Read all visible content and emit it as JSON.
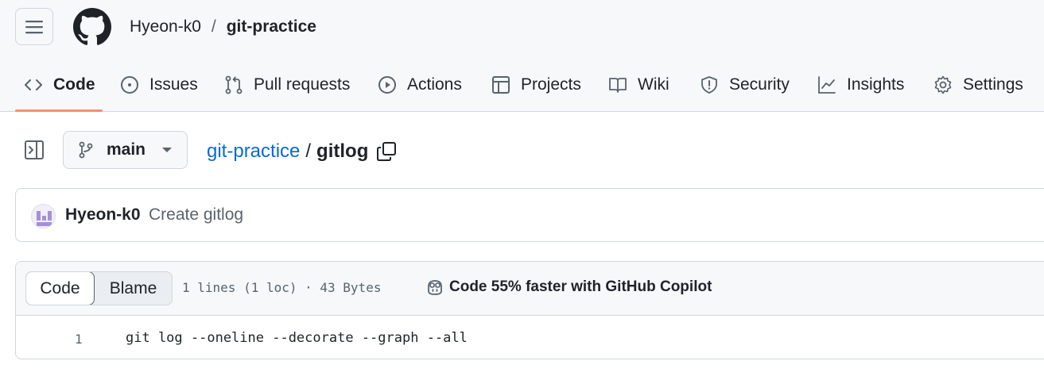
{
  "header": {
    "owner": "Hyeon-k0",
    "separator": "/",
    "repo": "git-practice"
  },
  "tabs": [
    {
      "label": "Code",
      "icon": "code-icon",
      "selected": true
    },
    {
      "label": "Issues",
      "icon": "issue-opened-icon"
    },
    {
      "label": "Pull requests",
      "icon": "git-pull-request-icon"
    },
    {
      "label": "Actions",
      "icon": "play-icon"
    },
    {
      "label": "Projects",
      "icon": "table-icon"
    },
    {
      "label": "Wiki",
      "icon": "book-icon"
    },
    {
      "label": "Security",
      "icon": "shield-icon"
    },
    {
      "label": "Insights",
      "icon": "graph-icon"
    },
    {
      "label": "Settings",
      "icon": "gear-icon"
    }
  ],
  "file_nav": {
    "branch": "main",
    "path_repo": "git-practice",
    "path_separator": "/",
    "file_name": "gitlog"
  },
  "commit": {
    "author": "Hyeon-k0",
    "message": "Create gitlog"
  },
  "code_view": {
    "code_tab": "Code",
    "blame_tab": "Blame",
    "file_info": "1 lines (1 loc) · 43 Bytes",
    "copilot_text": "Code 55% faster with GitHub Copilot",
    "lines": [
      {
        "number": "1",
        "text": "git log --oneline --decorate --graph --all"
      }
    ]
  },
  "colors": {
    "accent_underline": "#fd8c73",
    "link": "#0969da",
    "header_bg": "#f6f8fa",
    "border": "#d0d7de"
  }
}
